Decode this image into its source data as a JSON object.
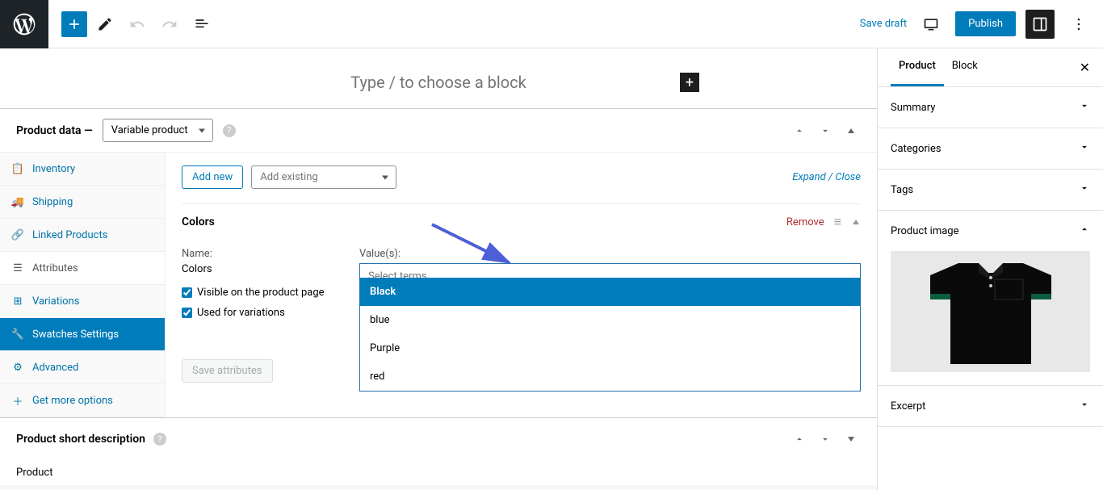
{
  "topbar": {
    "save_draft": "Save draft",
    "publish": "Publish"
  },
  "editor": {
    "placeholder": "Type / to choose a block"
  },
  "product_data": {
    "label": "Product data —",
    "type_selected": "Variable product",
    "tabs": [
      {
        "icon": "inventory",
        "label": "Inventory"
      },
      {
        "icon": "shipping",
        "label": "Shipping"
      },
      {
        "icon": "link",
        "label": "Linked Products"
      },
      {
        "icon": "list",
        "label": "Attributes"
      },
      {
        "icon": "grid",
        "label": "Variations"
      },
      {
        "icon": "wrench",
        "label": "Swatches Settings"
      },
      {
        "icon": "gear",
        "label": "Advanced"
      },
      {
        "icon": "plus",
        "label": "Get more options"
      }
    ],
    "add_new": "Add new",
    "add_existing_placeholder": "Add existing",
    "expand_close": "Expand / Close",
    "attribute": {
      "title": "Colors",
      "remove": "Remove",
      "name_label": "Name:",
      "name_value": "Colors",
      "visible_label": "Visible on the product page",
      "variations_label": "Used for variations",
      "values_label": "Value(s):",
      "select_placeholder": "Select terms",
      "options": [
        "Black",
        "blue",
        "Purple",
        "red"
      ]
    },
    "save_attributes": "Save attributes"
  },
  "short_description": {
    "title": "Product short description"
  },
  "footer": {
    "label": "Product"
  },
  "sidebar": {
    "tabs": {
      "product": "Product",
      "block": "Block"
    },
    "panels": {
      "summary": "Summary",
      "categories": "Categories",
      "tags": "Tags",
      "product_image": "Product image",
      "excerpt": "Excerpt"
    }
  }
}
